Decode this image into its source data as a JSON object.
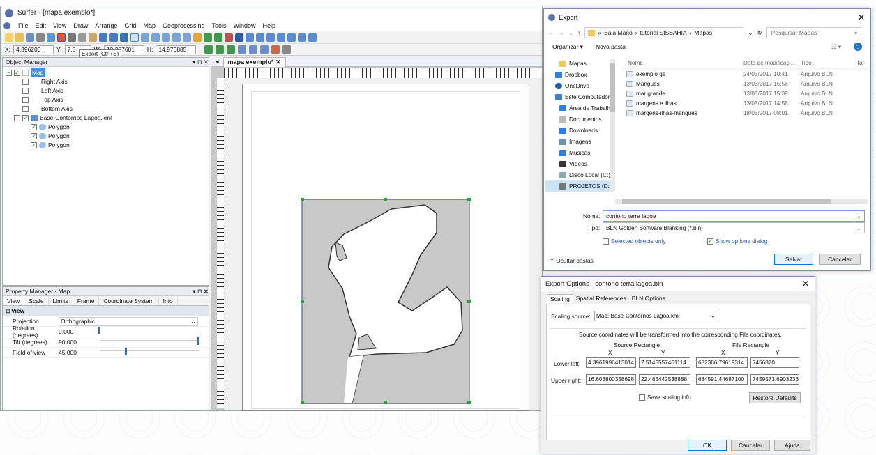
{
  "surfer": {
    "title": "Surfer - [mapa exemplo*]",
    "menu": [
      "File",
      "Edit",
      "View",
      "Draw",
      "Arrange",
      "Grid",
      "Map",
      "Geoprocessing",
      "Tools",
      "Window",
      "Help"
    ],
    "tooltip": "Export (Ctrl+E)",
    "coords": {
      "x_label": "X:",
      "x": "4.396200",
      "y_label": "Y:",
      "y": "7.5",
      "w_label": "W:",
      "w": "12.207601",
      "h_label": "H:",
      "h": "14.970885"
    },
    "object_manager": {
      "title": "Object Manager",
      "items": [
        {
          "label": "Map",
          "checked": true,
          "selected": true
        },
        {
          "label": "Right Axis",
          "checked": false
        },
        {
          "label": "Left Axis",
          "checked": false
        },
        {
          "label": "Top Axis",
          "checked": false
        },
        {
          "label": "Bottom Axis",
          "checked": false
        },
        {
          "label": "Base-Contornos Lagoa.kml",
          "checked": true
        },
        {
          "label": "Polygon",
          "checked": true
        },
        {
          "label": "Polygon",
          "checked": true
        },
        {
          "label": "Polygon",
          "checked": true
        }
      ]
    },
    "property_manager": {
      "title": "Property Manager - Map",
      "tabs": [
        "View",
        "Scale",
        "Limits",
        "Frame",
        "Coordinate System",
        "Info"
      ],
      "section": "View",
      "rows": [
        {
          "label": "Projection",
          "value": "Orthographic"
        },
        {
          "label": "Rotation (degrees)",
          "value": "0.000",
          "slider": 0.0
        },
        {
          "label": "Tilt (degrees)",
          "value": "90.000",
          "slider": 1.0
        },
        {
          "label": "Field of view",
          "value": "45.000",
          "slider": 0.27
        }
      ]
    },
    "doc_tab": "mapa exemplo*"
  },
  "export": {
    "title": "Export",
    "path": [
      "«",
      "Baia Mano",
      "›",
      "tutorial SISBAHIA",
      "›",
      "Mapas"
    ],
    "search_placeholder": "Pesquisar Mapas",
    "organize": "Organizar ▾",
    "new_folder": "Nova pasta",
    "nav": [
      "Mapas",
      "Dropbox",
      "OneDrive",
      "Este Computador",
      "Área de Trabalho",
      "Documentos",
      "Downloads",
      "Imagens",
      "Músicas",
      "Vídeos",
      "Disco Local (C:)",
      "PROJETOS (D:)"
    ],
    "columns": [
      "Nome",
      "Data de modificaç...",
      "Tipo",
      "Tar"
    ],
    "files": [
      {
        "name": "exemplo ge",
        "date": "24/03/2017 10:41",
        "type": "Arquivo BLN"
      },
      {
        "name": "Mangues",
        "date": "13/03/2017 15:56",
        "type": "Arquivo BLN"
      },
      {
        "name": "mar grande",
        "date": "13/03/2017 15:39",
        "type": "Arquivo BLN"
      },
      {
        "name": "margens e ilhas",
        "date": "13/03/2017 14:58",
        "type": "Arquivo BLN"
      },
      {
        "name": "margens-ilhas-mangues",
        "date": "18/03/2017 08:01",
        "type": "Arquivo BLN"
      }
    ],
    "name_label": "Nome:",
    "name_value": "contono terra lagoa",
    "type_label": "Tipo:",
    "type_value": "BLN Golden Software Blanking (*.bln)",
    "selected_only": "Selected objects only",
    "show_options": "Show options dialog",
    "hide_folders": "Ocultar pastas",
    "save": "Salvar",
    "cancel": "Cancelar"
  },
  "options": {
    "title": "Export Options - contono terra lagoa.bln",
    "tabs": [
      "Scaling",
      "Spatial References",
      "BLN Options"
    ],
    "source_label": "Scaling source:",
    "source_value": "Map: Base-Contornos Lagoa.kml",
    "note": "Source coordinates will be transformed into the corresponding File coordinates.",
    "source_rect": "Source Rectangle",
    "file_rect": "File Rectangle",
    "x": "X",
    "y": "Y",
    "lower_left": "Lower left:",
    "upper_right": "Upper right:",
    "ll_src_x": "4.3961996413014",
    "ll_src_y": "7.5145557461114",
    "ll_file_x": "682386.79619314",
    "ll_file_y": "7456870",
    "ur_src_x": "16.603800358698",
    "ur_src_y": "22.485442538888",
    "ur_file_x": "684591.44687100",
    "ur_file_y": "7459573.6903236",
    "save_scaling": "Save scaling info",
    "restore": "Restore Defaults",
    "ok": "OK",
    "cancel": "Cancelar",
    "help": "Ajuda"
  }
}
